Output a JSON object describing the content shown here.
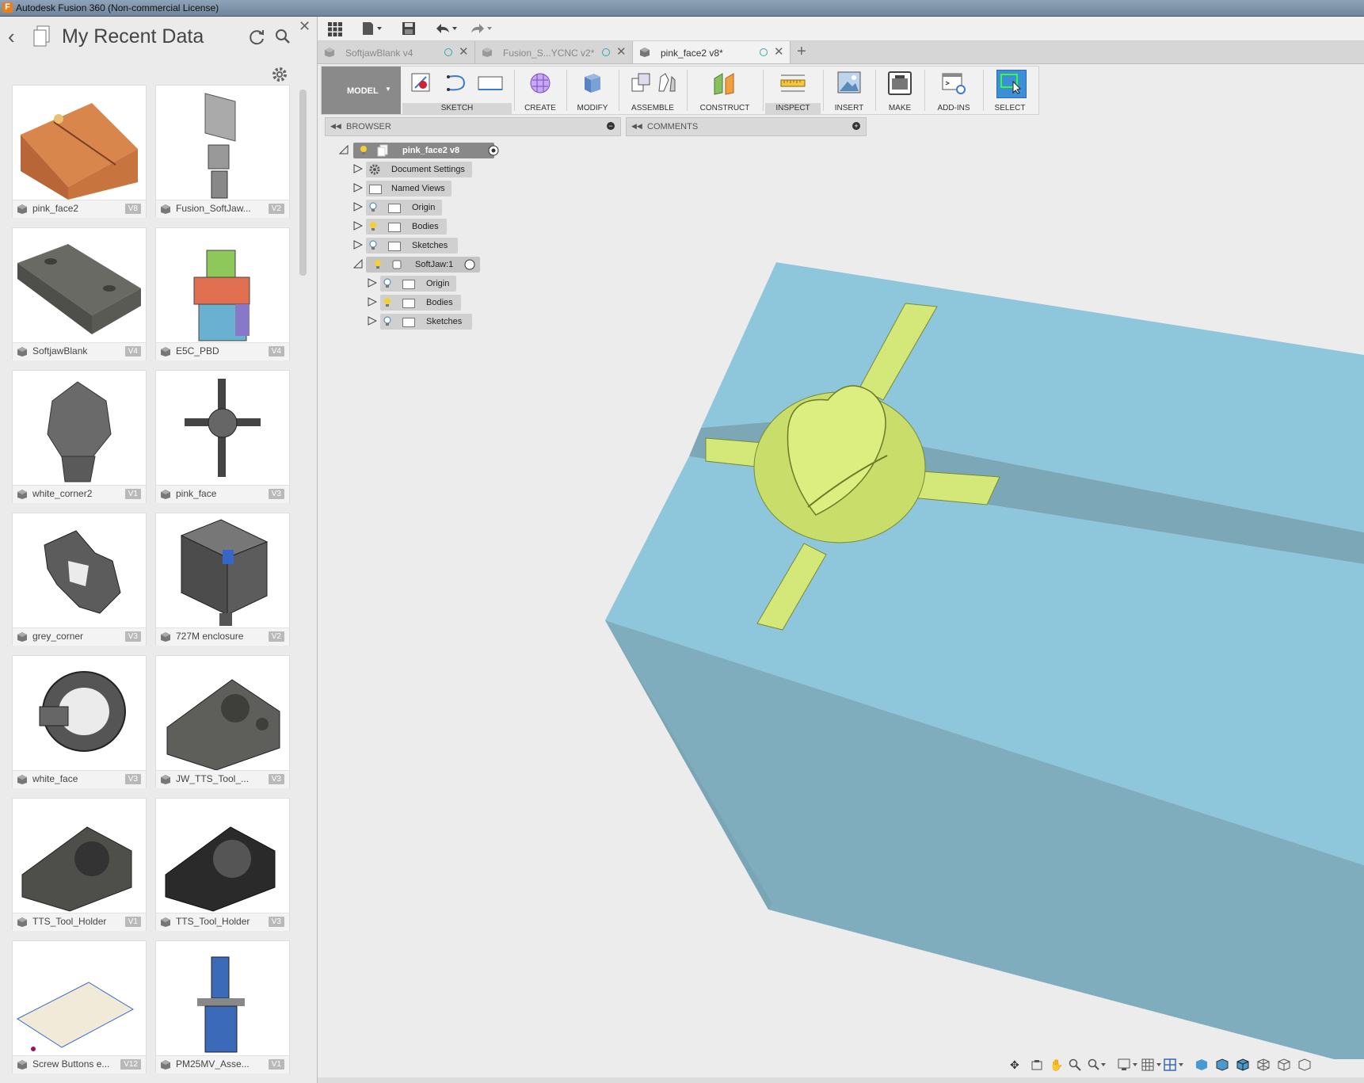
{
  "window": {
    "title": "Autodesk Fusion 360 (Non-commercial License)"
  },
  "data_panel": {
    "title": "My Recent Data",
    "items": [
      {
        "name": "pink_face2",
        "version": "V8"
      },
      {
        "name": "Fusion_SoftJaw...",
        "version": "V2"
      },
      {
        "name": "SoftjawBlank",
        "version": "V4"
      },
      {
        "name": "E5C_PBD",
        "version": "V4"
      },
      {
        "name": "white_corner2",
        "version": "V1"
      },
      {
        "name": "pink_face",
        "version": "V3"
      },
      {
        "name": "grey_corner",
        "version": "V3"
      },
      {
        "name": "727M enclosure",
        "version": "V2"
      },
      {
        "name": "white_face",
        "version": "V3"
      },
      {
        "name": "JW_TTS_Tool_...",
        "version": "V3"
      },
      {
        "name": "TTS_Tool_Holder",
        "version": "V1"
      },
      {
        "name": "TTS_Tool_Holder",
        "version": "V3"
      },
      {
        "name": "Screw Buttons e...",
        "version": "V12"
      },
      {
        "name": "PM25MV_Asse...",
        "version": "V1"
      }
    ]
  },
  "tabs": [
    {
      "label": "SoftjawBlank v4"
    },
    {
      "label": "Fusion_S...YCNC v2*"
    },
    {
      "label": "pink_face2 v8*",
      "active": true
    }
  ],
  "toolbar": {
    "workspace": "MODEL",
    "groups": [
      {
        "label": "SKETCH"
      },
      {
        "label": "CREATE"
      },
      {
        "label": "MODIFY"
      },
      {
        "label": "ASSEMBLE"
      },
      {
        "label": "CONSTRUCT"
      },
      {
        "label": "INSPECT"
      },
      {
        "label": "INSERT"
      },
      {
        "label": "MAKE"
      },
      {
        "label": "ADD-INS"
      },
      {
        "label": "SELECT"
      }
    ]
  },
  "browser": {
    "title": "BROWSER",
    "comments_title": "COMMENTS",
    "root": "pink_face2 v8",
    "nodes": [
      {
        "label": "Document Settings"
      },
      {
        "label": "Named Views"
      },
      {
        "label": "Origin"
      },
      {
        "label": "Bodies"
      },
      {
        "label": "Sketches"
      },
      {
        "label": "SoftJaw:1"
      },
      {
        "label": "Origin"
      },
      {
        "label": "Bodies"
      },
      {
        "label": "Sketches"
      }
    ]
  },
  "colors": {
    "body_top": "#8fc8dc",
    "body_front": "#7eabbd",
    "pocket_part": "#d4e87a",
    "toolbar_select": "#3c8fd6"
  }
}
